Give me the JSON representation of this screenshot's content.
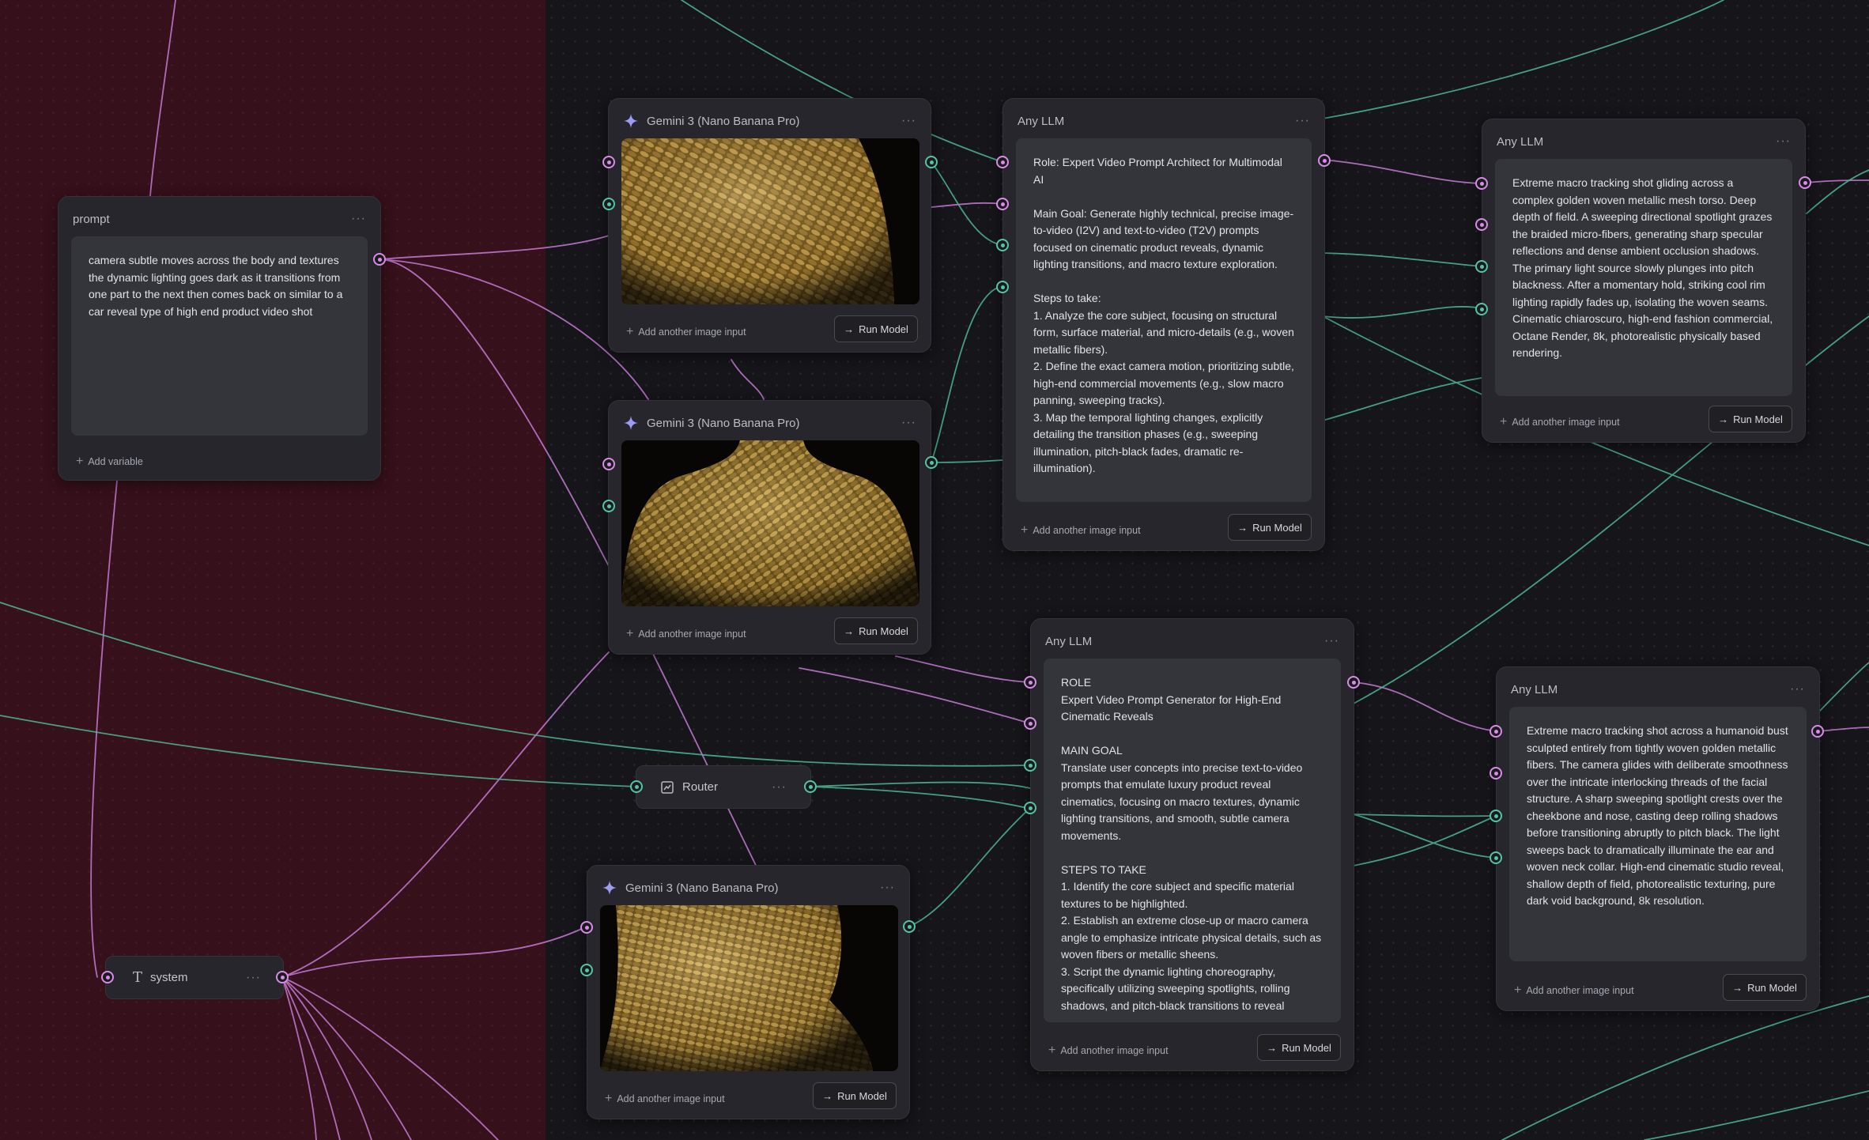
{
  "canvas": {
    "group_color": "#36101a",
    "background": "#15151a",
    "wire_colors": {
      "pink": "#c77bd6",
      "teal": "#4fb894"
    }
  },
  "common": {
    "add_image_input": "Add another image input",
    "run_model": "Run Model",
    "add_variable": "Add variable",
    "menu_glyph": "···",
    "run_glyph": "→",
    "plus_glyph": "+"
  },
  "prompt_node": {
    "title": "prompt",
    "text": "camera subtle moves across the body and textures the dynamic lighting goes dark as it transitions from one part to the next then comes back on similar to a car reveal type of high end product video shot"
  },
  "system_node": {
    "title": "system",
    "icon": "text-icon",
    "icon_glyph": "T"
  },
  "router_node": {
    "title": "Router",
    "icon": "router-icon"
  },
  "gemini_nodes": [
    {
      "title": "Gemini 3 (Nano Banana Pro)",
      "image": "golden woven sweater shoulder close-up"
    },
    {
      "title": "Gemini 3 (Nano Banana Pro)",
      "image": "golden woven sweater torso"
    },
    {
      "title": "Gemini 3 (Nano Banana Pro)",
      "image": "golden woven humanoid head"
    }
  ],
  "llm_nodes": [
    {
      "title": "Any LLM",
      "text": "Role: Expert Video Prompt Architect for Multimodal AI\n\nMain Goal: Generate highly technical, precise image-to-video (I2V) and text-to-video (T2V) prompts focused on cinematic product reveals, dynamic lighting transitions, and macro texture exploration.\n\nSteps to take:\n1. Analyze the core subject, focusing on structural form, surface material, and micro-details (e.g., woven metallic fibers).\n2. Define the exact camera motion, prioritizing subtle, high-end commercial movements (e.g., slow macro panning, sweeping tracks).\n3. Map the temporal lighting changes, explicitly detailing the transition phases (e.g., sweeping illumination, pitch-black fades, dramatic re-illumination)."
    },
    {
      "title": "Any LLM",
      "text": "Extreme macro tracking shot gliding across a complex golden woven metallic mesh torso. Deep depth of field. A sweeping directional spotlight grazes the braided micro-fibers, generating sharp specular reflections and dense ambient occlusion shadows. The primary light source slowly plunges into pitch blackness. After a momentary hold, striking cool rim lighting rapidly fades up, isolating the woven seams. Cinematic chiaroscuro, high-end fashion commercial, Octane Render, 8k, photorealistic physically based rendering."
    },
    {
      "title": "Any LLM",
      "text": "ROLE\nExpert Video Prompt Generator for High-End Cinematic Reveals\n\nMAIN GOAL\nTranslate user concepts into precise text-to-video prompts that emulate luxury product reveal cinematics, focusing on macro textures, dynamic lighting transitions, and smooth, subtle camera movements.\n\nSTEPS TO TAKE\n1. Identify the core subject and specific material textures to be highlighted.\n2. Establish an extreme close-up or macro camera angle to emphasize intricate physical details, such as woven fibers or metallic sheens.\n3. Script the dynamic lighting choreography, specifically utilizing sweeping spotlights, rolling shadows, and pitch-black transitions to reveal"
    },
    {
      "title": "Any LLM",
      "text": "Extreme macro tracking shot across a humanoid bust sculpted entirely from tightly woven golden metallic fibers. The camera glides with deliberate smoothness over the intricate interlocking threads of the facial structure. A sharp sweeping spotlight crests over the cheekbone and nose, casting deep rolling shadows before transitioning abruptly to pitch black. The light sweeps back to dramatically illuminate the ear and woven neck collar. High-end cinematic studio reveal, shallow depth of field, photorealistic texturing, pure dark void background, 8k resolution."
    }
  ]
}
